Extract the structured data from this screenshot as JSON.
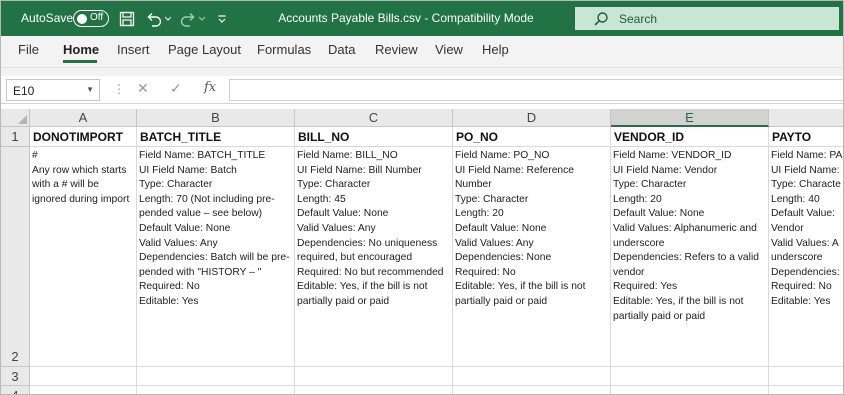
{
  "titlebar": {
    "autosave_label": "AutoSave",
    "autosave_state": "Off",
    "document_title": "Accounts Payable Bills.csv  -  Compatibility Mode",
    "search_placeholder": "Search",
    "accent_color": "#217346"
  },
  "quick_access": {
    "icons": [
      "save-icon",
      "undo-icon",
      "redo-icon",
      "customize-icon"
    ]
  },
  "ribbon": {
    "tabs": [
      "File",
      "Home",
      "Insert",
      "Page Layout",
      "Formulas",
      "Data",
      "Review",
      "View",
      "Help"
    ],
    "active_tab": "Home"
  },
  "formula_bar": {
    "name_box": "E10",
    "fx_label": "fx",
    "formula": ""
  },
  "sheet": {
    "columns": [
      "A",
      "B",
      "C",
      "D",
      "E",
      ""
    ],
    "selected_column": "E",
    "rows": [
      "1",
      "2",
      "3",
      "4"
    ],
    "header_row": [
      "DONOTIMPORT",
      "BATCH_TITLE",
      "BILL_NO",
      "PO_NO",
      "VENDOR_ID",
      "PAYTO"
    ],
    "row2": [
      [
        "#",
        "Any row which starts",
        "with a # will be",
        "ignored during import"
      ],
      [
        "Field Name: BATCH_TITLE",
        "UI Field Name: Batch",
        "Type: Character",
        "Length: 70 (Not including pre-",
        "pended value – see below)",
        "Default Value: None",
        "Valid Values: Any",
        "Dependencies: Batch will be pre-",
        "pended with \"HISTORY – \"",
        "Required: No",
        "Editable: Yes"
      ],
      [
        "Field Name: BILL_NO",
        "UI Field Name: Bill Number",
        "Type: Character",
        "Length: 45",
        "Default Value: None",
        "Valid Values: Any",
        "Dependencies: No uniqueness",
        "required, but encouraged",
        "Required: No but recommended",
        "Editable: Yes, if the bill is not",
        "partially paid or paid"
      ],
      [
        "Field Name: PO_NO",
        "UI Field Name: Reference",
        "Number",
        "Type: Character",
        "Length: 20",
        "Default Value: None",
        "Valid Values: Any",
        "Dependencies: None",
        "Required: No",
        "Editable: Yes, if the bill is not",
        "partially paid or paid"
      ],
      [
        "Field Name: VENDOR_ID",
        "UI Field Name: Vendor",
        "Type: Character",
        "Length: 20",
        "Default Value: None",
        "Valid Values: Alphanumeric and",
        "underscore",
        "Dependencies: Refers to a valid",
        "vendor",
        "Required: Yes",
        "Editable: Yes, if the bill is not",
        "partially paid or paid"
      ],
      [
        "Field Name: PA",
        "UI Field Name:",
        "Type: Characte",
        "Length: 40",
        "Default Value:",
        "Vendor",
        "Valid Values: A",
        "underscore",
        "Dependencies:",
        "Required: No",
        "Editable: Yes"
      ]
    ]
  }
}
